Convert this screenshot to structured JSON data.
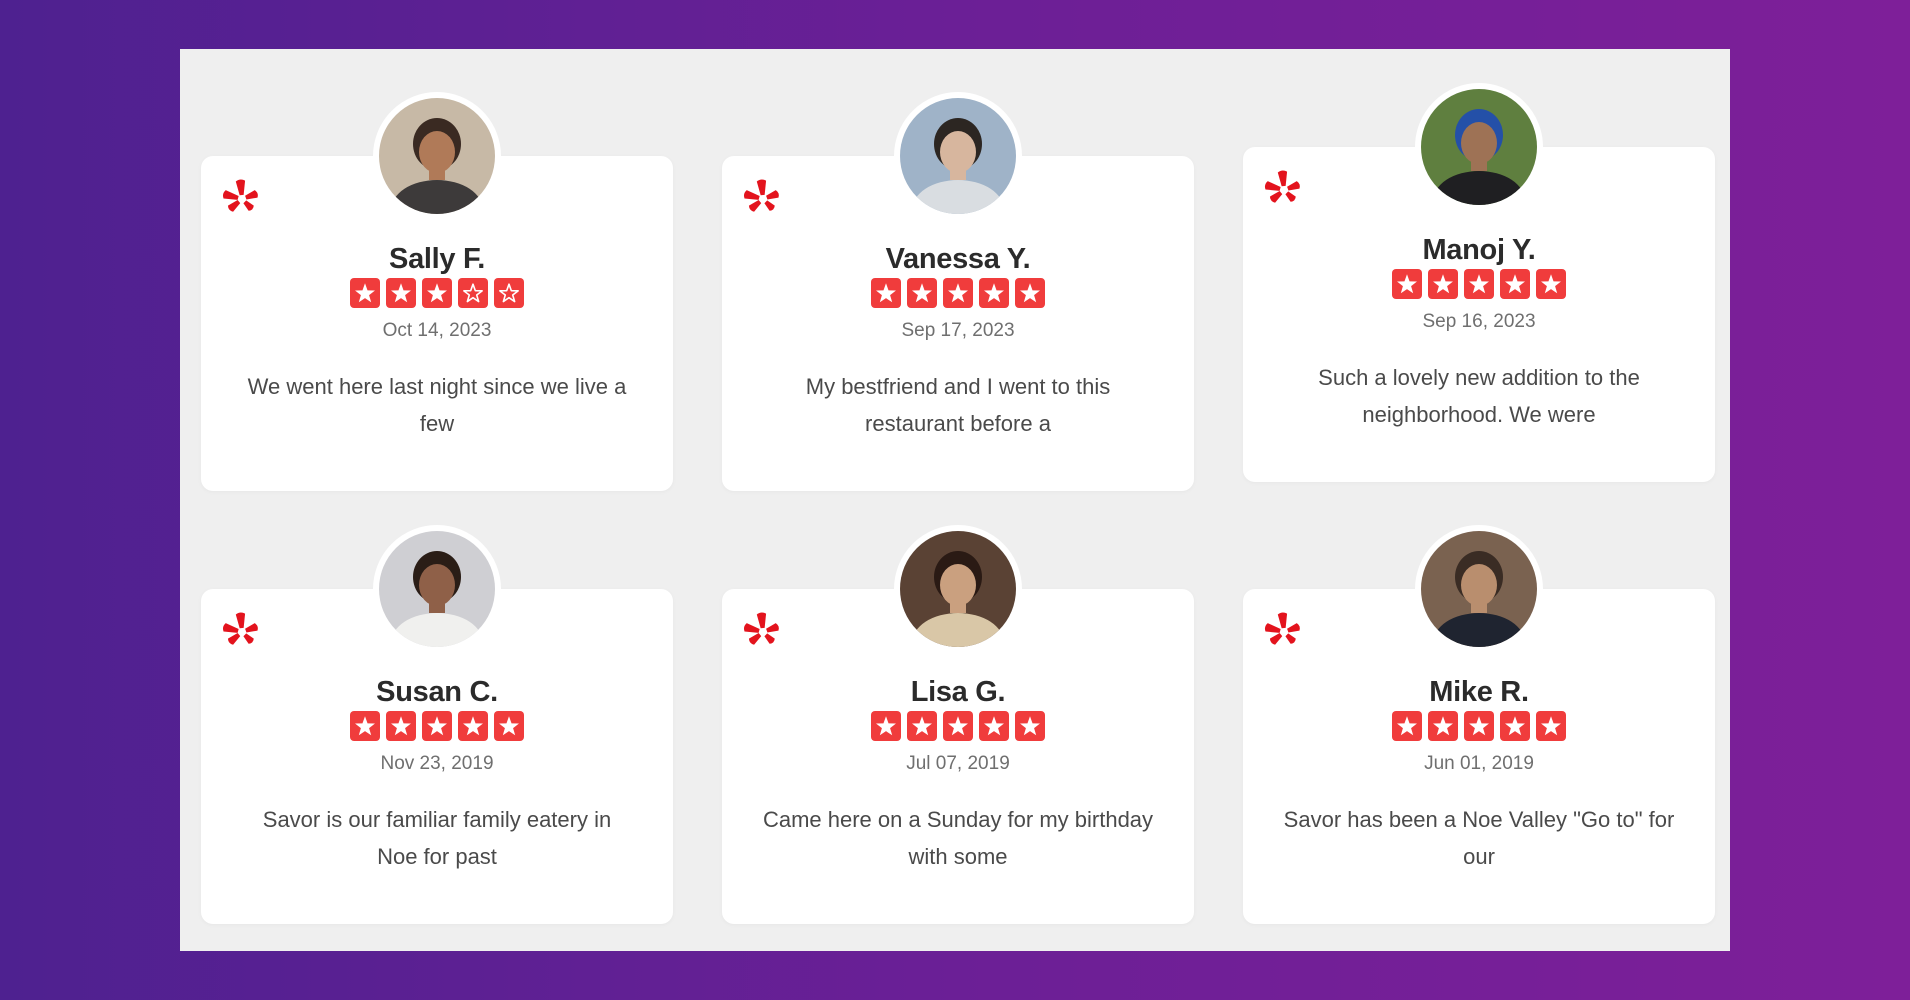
{
  "colors": {
    "accent": "#f03c3c",
    "yelp": "#e3131d",
    "panel": "#efefef",
    "background_left": "#4e2190",
    "background_right": "#7e1f99"
  },
  "icons": {
    "yelp": "yelp-burst-icon",
    "star": "star-icon",
    "star_outline": "star-outline-icon"
  },
  "reviews": [
    {
      "name": "Sally F.",
      "rating": 3,
      "date": "Oct 14, 2023",
      "text": "We went here last night since we live a few",
      "avatar": {
        "bg": "#c7b9a6",
        "skin": "#b07a58",
        "hair": "#3a2a22",
        "shirt": "#3d3a3a"
      }
    },
    {
      "name": "Vanessa Y.",
      "rating": 5,
      "date": "Sep 17, 2023",
      "text": "My bestfriend and I went to this restaurant before a",
      "avatar": {
        "bg": "#9fb3c8",
        "skin": "#d7b69e",
        "hair": "#2c2622",
        "shirt": "#d9dde1"
      }
    },
    {
      "name": "Manoj Y.",
      "rating": 5,
      "date": "Sep 16, 2023",
      "text": "Such a lovely new addition to the neighborhood. We were",
      "avatar": {
        "bg": "#5f7f3f",
        "skin": "#9e7255",
        "hair": "#2450a8",
        "shirt": "#1f1f22"
      }
    },
    {
      "name": "Susan C.",
      "rating": 5,
      "date": "Nov 23, 2019",
      "text": "Savor is our familiar family eatery in Noe for past",
      "avatar": {
        "bg": "#cfcfd3",
        "skin": "#8f6048",
        "hair": "#2a1d16",
        "shirt": "#f0f0ee"
      }
    },
    {
      "name": "Lisa G.",
      "rating": 5,
      "date": "Jul 07, 2019",
      "text": "Came here on a Sunday for my birthday with some",
      "avatar": {
        "bg": "#5a4234",
        "skin": "#caa07f",
        "hair": "#2a1a14",
        "shirt": "#d9c7a7"
      }
    },
    {
      "name": "Mike R.",
      "rating": 5,
      "date": "Jun 01, 2019",
      "text": "Savor has been a Noe Valley \"Go to\" for our",
      "avatar": {
        "bg": "#7a6250",
        "skin": "#b98e6e",
        "hair": "#3a2c24",
        "shirt": "#1f2430"
      }
    }
  ]
}
